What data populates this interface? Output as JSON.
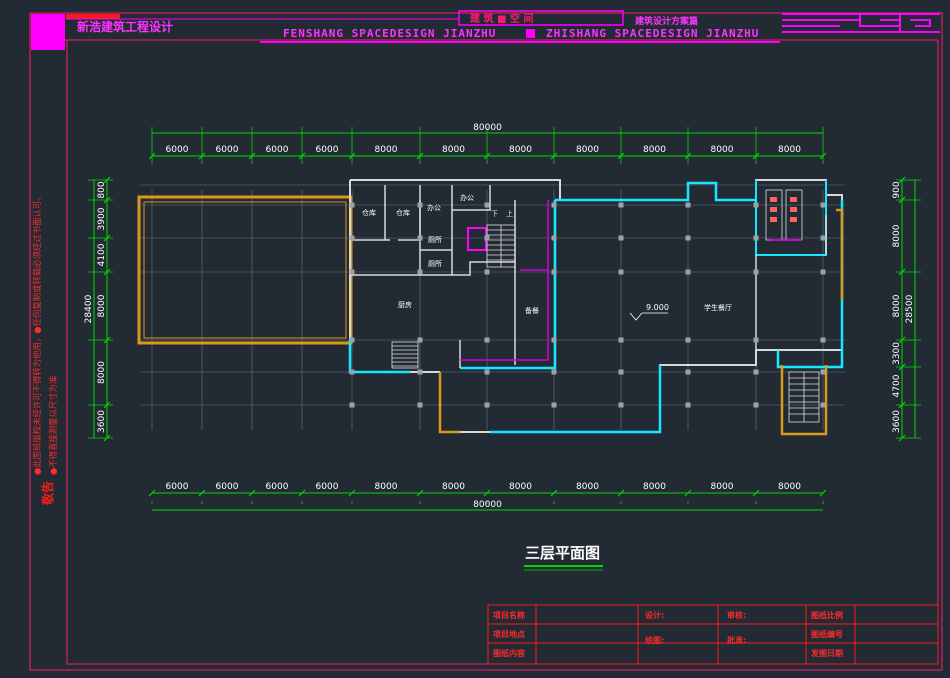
{
  "header": {
    "firm": "新浩建筑工程设计",
    "banner_left": "FENSHANG SPACEDESIGN JIANZHU",
    "banner_right": "ZHISHANG SPACEDESIGN JIANZHU",
    "box_title": "建 筑 ■ 空 间",
    "scheme_label": "建筑设计方案篇"
  },
  "notice": {
    "heading": "敬告",
    "line1": "●此图纸版权未经许可不得转为他用，●任何复制或转载必须经过书面认可。",
    "line2": "●不得直接测量以尺寸为准"
  },
  "dims": {
    "total": "80000",
    "top_spans": [
      "6000",
      "6000",
      "6000",
      "6000",
      "8000",
      "8000",
      "8000",
      "8000",
      "8000",
      "8000",
      "8000"
    ],
    "bottom_spans": [
      "6000",
      "6000",
      "6000",
      "6000",
      "8000",
      "8000",
      "8000",
      "8000",
      "8000",
      "8000",
      "8000"
    ],
    "left_spans": [
      "800",
      "3900",
      "4100",
      "8000",
      "8000",
      "3600"
    ],
    "left_total": "28400",
    "right_spans": [
      "900",
      "8000",
      "8000",
      "3300",
      "4700",
      "3600"
    ],
    "right_total": "28500"
  },
  "rooms": {
    "store1": "仓库",
    "store2": "仓库",
    "office1": "办公",
    "office2": "办公",
    "wc1": "厕所",
    "wc2": "厕所",
    "kitchen": "厨房",
    "serving": "备餐",
    "canteen": "学生餐厅",
    "level": "9.000",
    "up": "上",
    "down": "下"
  },
  "plan_title": "三层平面图",
  "title_block": {
    "project_name": "项目名称",
    "project_site": "项目地点",
    "drawing_content": "图纸内容",
    "design": "设计:",
    "review": "审核:",
    "drawn": "绘图:",
    "approve": "批准:",
    "scale": "图纸比例",
    "number": "图纸编号",
    "issue_date": "发图日期"
  },
  "colors": {
    "background": "#222a34",
    "frame": "#ff1a6e",
    "magenta": "#ff00ff",
    "dimension": "#00d800",
    "wall": "#d8d8d8",
    "cyan": "#17e6ff",
    "balcony": "#d99a1a"
  }
}
